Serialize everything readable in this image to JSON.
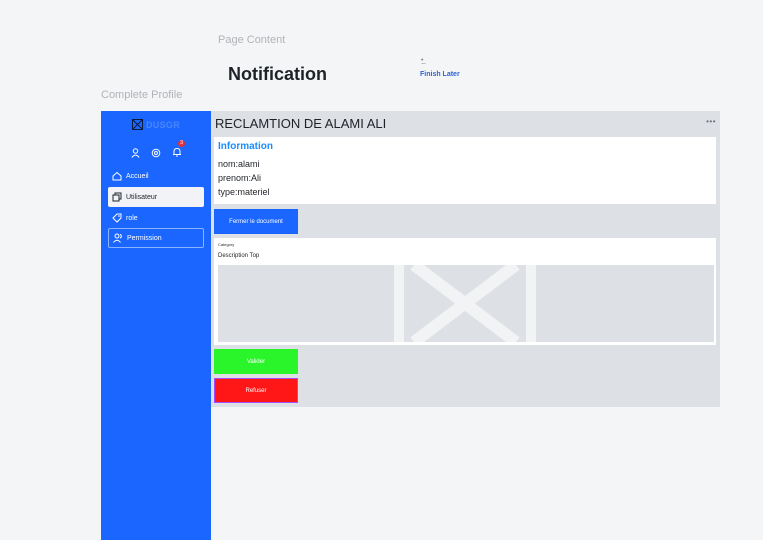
{
  "header": {
    "page_label": "Page Content",
    "title": "Notification",
    "finish_later": "Finish Later",
    "finish_marker": "•̲",
    "complete_label": "Complete Profile"
  },
  "sidebar": {
    "brand": "DUSGR",
    "notification_count": "3",
    "items": [
      {
        "label": "Accueil",
        "icon": "home-icon"
      },
      {
        "label": "Utilisateur",
        "icon": "copy-icon"
      },
      {
        "label": "role",
        "icon": "tag-icon"
      },
      {
        "label": "Permission",
        "icon": "users-icon"
      }
    ]
  },
  "main": {
    "title": "RECLAMTION DE ALAMI ALI",
    "more": "•••",
    "info": {
      "heading": "Information",
      "lines": [
        "nom:alami",
        "prenom:Ali",
        "type:materiel"
      ]
    },
    "close_doc_label": "Fermer le document",
    "category_label": "Category",
    "description": "Description Top",
    "validate_label": "Valider",
    "refuse_label": "Refuser"
  },
  "colors": {
    "primary": "#1a66ff",
    "validate": "#2af52a",
    "refuse": "#ff1616",
    "info_heading": "#1a8cff"
  }
}
